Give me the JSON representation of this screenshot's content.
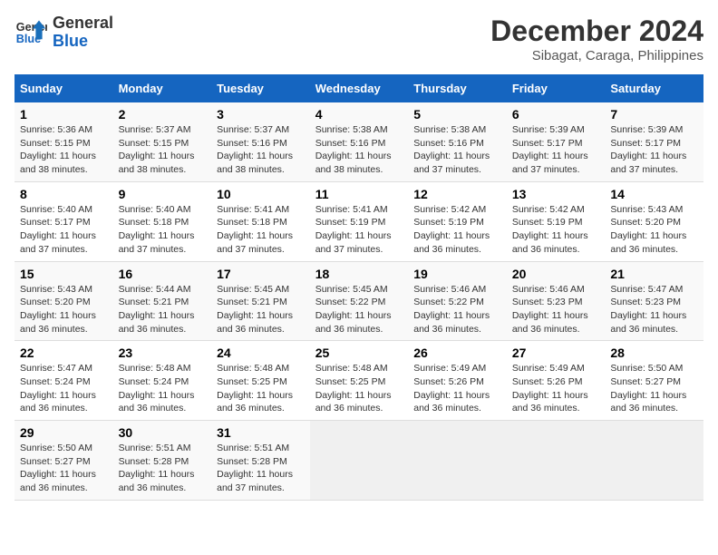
{
  "logo": {
    "name_line1": "General",
    "name_line2": "Blue"
  },
  "title": "December 2024",
  "subtitle": "Sibagat, Caraga, Philippines",
  "headers": [
    "Sunday",
    "Monday",
    "Tuesday",
    "Wednesday",
    "Thursday",
    "Friday",
    "Saturday"
  ],
  "weeks": [
    [
      {
        "day": "1",
        "sunrise": "Sunrise: 5:36 AM",
        "sunset": "Sunset: 5:15 PM",
        "daylight": "Daylight: 11 hours and 38 minutes."
      },
      {
        "day": "2",
        "sunrise": "Sunrise: 5:37 AM",
        "sunset": "Sunset: 5:15 PM",
        "daylight": "Daylight: 11 hours and 38 minutes."
      },
      {
        "day": "3",
        "sunrise": "Sunrise: 5:37 AM",
        "sunset": "Sunset: 5:16 PM",
        "daylight": "Daylight: 11 hours and 38 minutes."
      },
      {
        "day": "4",
        "sunrise": "Sunrise: 5:38 AM",
        "sunset": "Sunset: 5:16 PM",
        "daylight": "Daylight: 11 hours and 38 minutes."
      },
      {
        "day": "5",
        "sunrise": "Sunrise: 5:38 AM",
        "sunset": "Sunset: 5:16 PM",
        "daylight": "Daylight: 11 hours and 37 minutes."
      },
      {
        "day": "6",
        "sunrise": "Sunrise: 5:39 AM",
        "sunset": "Sunset: 5:17 PM",
        "daylight": "Daylight: 11 hours and 37 minutes."
      },
      {
        "day": "7",
        "sunrise": "Sunrise: 5:39 AM",
        "sunset": "Sunset: 5:17 PM",
        "daylight": "Daylight: 11 hours and 37 minutes."
      }
    ],
    [
      {
        "day": "8",
        "sunrise": "Sunrise: 5:40 AM",
        "sunset": "Sunset: 5:17 PM",
        "daylight": "Daylight: 11 hours and 37 minutes."
      },
      {
        "day": "9",
        "sunrise": "Sunrise: 5:40 AM",
        "sunset": "Sunset: 5:18 PM",
        "daylight": "Daylight: 11 hours and 37 minutes."
      },
      {
        "day": "10",
        "sunrise": "Sunrise: 5:41 AM",
        "sunset": "Sunset: 5:18 PM",
        "daylight": "Daylight: 11 hours and 37 minutes."
      },
      {
        "day": "11",
        "sunrise": "Sunrise: 5:41 AM",
        "sunset": "Sunset: 5:19 PM",
        "daylight": "Daylight: 11 hours and 37 minutes."
      },
      {
        "day": "12",
        "sunrise": "Sunrise: 5:42 AM",
        "sunset": "Sunset: 5:19 PM",
        "daylight": "Daylight: 11 hours and 36 minutes."
      },
      {
        "day": "13",
        "sunrise": "Sunrise: 5:42 AM",
        "sunset": "Sunset: 5:19 PM",
        "daylight": "Daylight: 11 hours and 36 minutes."
      },
      {
        "day": "14",
        "sunrise": "Sunrise: 5:43 AM",
        "sunset": "Sunset: 5:20 PM",
        "daylight": "Daylight: 11 hours and 36 minutes."
      }
    ],
    [
      {
        "day": "15",
        "sunrise": "Sunrise: 5:43 AM",
        "sunset": "Sunset: 5:20 PM",
        "daylight": "Daylight: 11 hours and 36 minutes."
      },
      {
        "day": "16",
        "sunrise": "Sunrise: 5:44 AM",
        "sunset": "Sunset: 5:21 PM",
        "daylight": "Daylight: 11 hours and 36 minutes."
      },
      {
        "day": "17",
        "sunrise": "Sunrise: 5:45 AM",
        "sunset": "Sunset: 5:21 PM",
        "daylight": "Daylight: 11 hours and 36 minutes."
      },
      {
        "day": "18",
        "sunrise": "Sunrise: 5:45 AM",
        "sunset": "Sunset: 5:22 PM",
        "daylight": "Daylight: 11 hours and 36 minutes."
      },
      {
        "day": "19",
        "sunrise": "Sunrise: 5:46 AM",
        "sunset": "Sunset: 5:22 PM",
        "daylight": "Daylight: 11 hours and 36 minutes."
      },
      {
        "day": "20",
        "sunrise": "Sunrise: 5:46 AM",
        "sunset": "Sunset: 5:23 PM",
        "daylight": "Daylight: 11 hours and 36 minutes."
      },
      {
        "day": "21",
        "sunrise": "Sunrise: 5:47 AM",
        "sunset": "Sunset: 5:23 PM",
        "daylight": "Daylight: 11 hours and 36 minutes."
      }
    ],
    [
      {
        "day": "22",
        "sunrise": "Sunrise: 5:47 AM",
        "sunset": "Sunset: 5:24 PM",
        "daylight": "Daylight: 11 hours and 36 minutes."
      },
      {
        "day": "23",
        "sunrise": "Sunrise: 5:48 AM",
        "sunset": "Sunset: 5:24 PM",
        "daylight": "Daylight: 11 hours and 36 minutes."
      },
      {
        "day": "24",
        "sunrise": "Sunrise: 5:48 AM",
        "sunset": "Sunset: 5:25 PM",
        "daylight": "Daylight: 11 hours and 36 minutes."
      },
      {
        "day": "25",
        "sunrise": "Sunrise: 5:48 AM",
        "sunset": "Sunset: 5:25 PM",
        "daylight": "Daylight: 11 hours and 36 minutes."
      },
      {
        "day": "26",
        "sunrise": "Sunrise: 5:49 AM",
        "sunset": "Sunset: 5:26 PM",
        "daylight": "Daylight: 11 hours and 36 minutes."
      },
      {
        "day": "27",
        "sunrise": "Sunrise: 5:49 AM",
        "sunset": "Sunset: 5:26 PM",
        "daylight": "Daylight: 11 hours and 36 minutes."
      },
      {
        "day": "28",
        "sunrise": "Sunrise: 5:50 AM",
        "sunset": "Sunset: 5:27 PM",
        "daylight": "Daylight: 11 hours and 36 minutes."
      }
    ],
    [
      {
        "day": "29",
        "sunrise": "Sunrise: 5:50 AM",
        "sunset": "Sunset: 5:27 PM",
        "daylight": "Daylight: 11 hours and 36 minutes."
      },
      {
        "day": "30",
        "sunrise": "Sunrise: 5:51 AM",
        "sunset": "Sunset: 5:28 PM",
        "daylight": "Daylight: 11 hours and 36 minutes."
      },
      {
        "day": "31",
        "sunrise": "Sunrise: 5:51 AM",
        "sunset": "Sunset: 5:28 PM",
        "daylight": "Daylight: 11 hours and 37 minutes."
      },
      null,
      null,
      null,
      null
    ]
  ]
}
